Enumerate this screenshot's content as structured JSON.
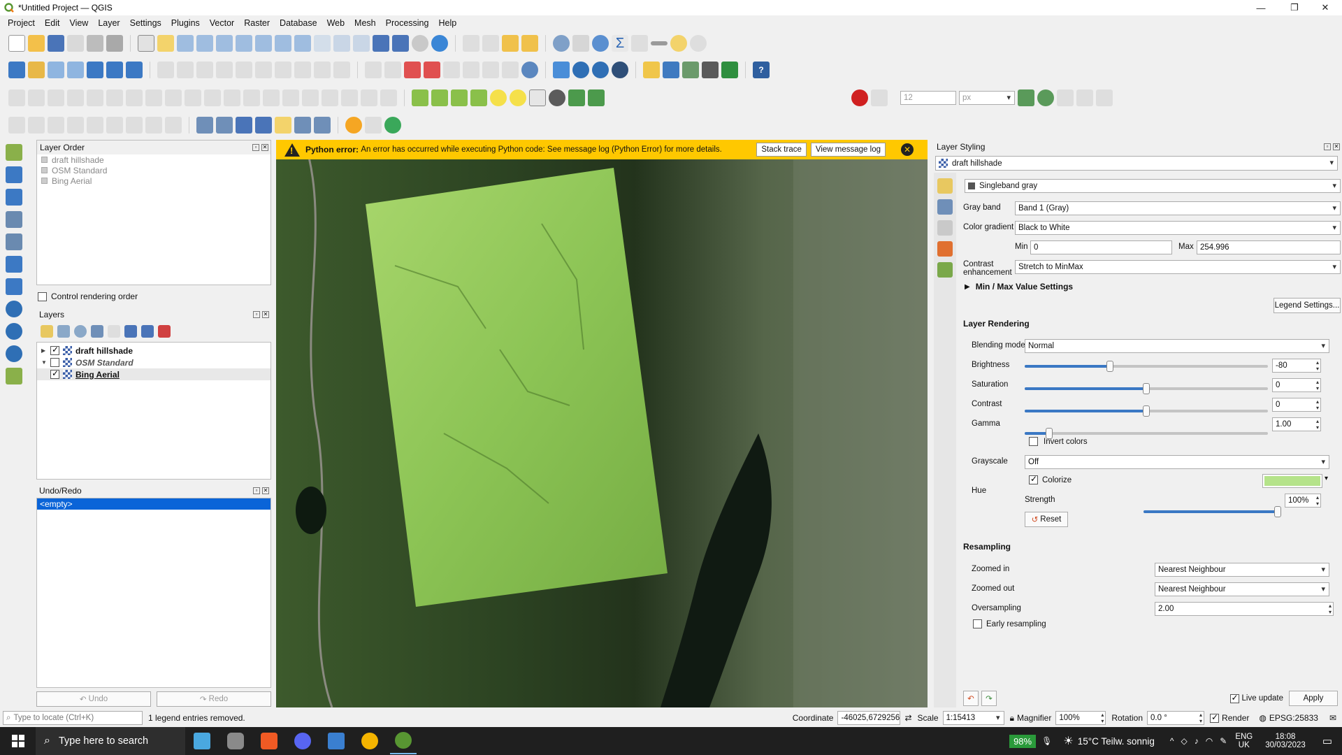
{
  "window": {
    "title": "*Untitled Project — QGIS",
    "minimize": "—",
    "maximize": "❐",
    "close": "✕"
  },
  "menu": [
    "Project",
    "Edit",
    "View",
    "Layer",
    "Settings",
    "Plugins",
    "Vector",
    "Raster",
    "Database",
    "Web",
    "Mesh",
    "Processing",
    "Help"
  ],
  "toolbar": {
    "symbol_size": "12",
    "symbol_unit": "px"
  },
  "layer_order": {
    "title": "Layer Order",
    "items": [
      "draft hillshade",
      "OSM Standard",
      "Bing Aerial"
    ],
    "control_label": "Control rendering order"
  },
  "layers": {
    "title": "Layers",
    "items": [
      {
        "name": "draft hillshade",
        "checked": true,
        "expanded": false
      },
      {
        "name": "OSM Standard",
        "checked": false,
        "expanded": true
      },
      {
        "name": "Bing Aerial",
        "checked": true,
        "expanded": false
      }
    ]
  },
  "undo": {
    "title": "Undo/Redo",
    "entry": "<empty>",
    "undo_label": "Undo",
    "redo_label": "Redo"
  },
  "error": {
    "title": "Python error:",
    "message": "An error has occurred while executing Python code: See message log (Python Error) for more details.",
    "stack_btn": "Stack trace",
    "log_btn": "View message log"
  },
  "styling": {
    "title": "Layer Styling",
    "layer": "draft hillshade",
    "renderer": "Singleband gray",
    "gray_band_label": "Gray band",
    "gray_band": "Band 1 (Gray)",
    "gradient_label": "Color gradient",
    "gradient": "Black to White",
    "min_label": "Min",
    "min": "0",
    "max_label": "Max",
    "max": "254.996",
    "contrast_label_1": "Contrast",
    "contrast_label_2": "enhancement",
    "contrast_enh": "Stretch to MinMax",
    "minmax_label": "Min / Max Value Settings",
    "legend_btn": "Legend Settings...",
    "rendering_title": "Layer Rendering",
    "blend_label": "Blending mode",
    "blend": "Normal",
    "brightness_label": "Brightness",
    "brightness": "-80",
    "saturation_label": "Saturation",
    "saturation": "0",
    "contrast_label": "Contrast",
    "contrast": "0",
    "gamma_label": "Gamma",
    "gamma": "1.00",
    "invert_label": "Invert colors",
    "grayscale_label": "Grayscale",
    "grayscale": "Off",
    "hue_label": "Hue",
    "colorize_label": "Colorize",
    "colorize_color": "#b5e38a",
    "strength_label": "Strength",
    "strength": "100%",
    "reset_btn": "Reset",
    "resampling_title": "Resampling",
    "zoomed_in_label": "Zoomed in",
    "zoomed_in": "Nearest Neighbour",
    "zoomed_out_label": "Zoomed out",
    "zoomed_out": "Nearest Neighbour",
    "oversampling_label": "Oversampling",
    "oversampling": "2.00",
    "early_label": "Early resampling",
    "live_label": "Live update",
    "apply_btn": "Apply",
    "sliders": {
      "brightness": 0.35,
      "saturation": 0.5,
      "contrast": 0.5,
      "gamma": 0.1,
      "strength": 1.0
    }
  },
  "status": {
    "locate_placeholder": "Type to locate (Ctrl+K)",
    "message": "1 legend entries removed.",
    "coord_label": "Coordinate",
    "coord": "-46025,6729256",
    "scale_label": "Scale",
    "scale": "1:15413",
    "magnifier_label": "Magnifier",
    "magnifier": "100%",
    "rotation_label": "Rotation",
    "rotation": "0.0 °",
    "render_label": "Render",
    "crs": "EPSG:25833"
  },
  "taskbar": {
    "search_placeholder": "Type here to search",
    "battery": "98%",
    "weather": "15°C  Teilw. sonnig",
    "lang1": "ENG",
    "lang2": "UK",
    "time": "18:08",
    "date": "30/03/2023"
  }
}
